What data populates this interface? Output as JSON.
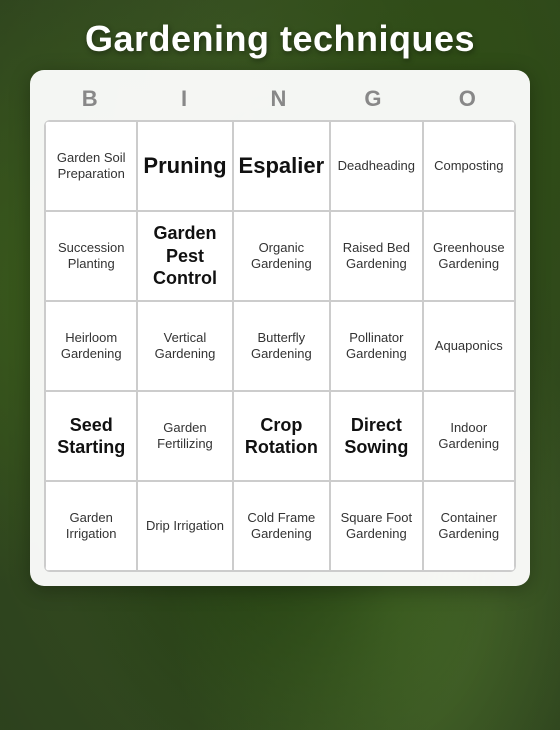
{
  "title": "Gardening techniques",
  "bingo_letters": [
    "B",
    "I",
    "N",
    "G",
    "O"
  ],
  "cells": [
    {
      "text": "Garden Soil Preparation",
      "size": "small"
    },
    {
      "text": "Pruning",
      "size": "large"
    },
    {
      "text": "Espalier",
      "size": "large"
    },
    {
      "text": "Deadheading",
      "size": "small"
    },
    {
      "text": "Composting",
      "size": "small"
    },
    {
      "text": "Succession Planting",
      "size": "small"
    },
    {
      "text": "Garden Pest Control",
      "size": "medium"
    },
    {
      "text": "Organic Gardening",
      "size": "small"
    },
    {
      "text": "Raised Bed Gardening",
      "size": "small"
    },
    {
      "text": "Greenhouse Gardening",
      "size": "small"
    },
    {
      "text": "Heirloom Gardening",
      "size": "small"
    },
    {
      "text": "Vertical Gardening",
      "size": "small"
    },
    {
      "text": "Butterfly Gardening",
      "size": "small"
    },
    {
      "text": "Pollinator Gardening",
      "size": "small"
    },
    {
      "text": "Aquaponics",
      "size": "small"
    },
    {
      "text": "Seed Starting",
      "size": "medium"
    },
    {
      "text": "Garden Fertilizing",
      "size": "small"
    },
    {
      "text": "Crop Rotation",
      "size": "medium"
    },
    {
      "text": "Direct Sowing",
      "size": "medium"
    },
    {
      "text": "Indoor Gardening",
      "size": "small"
    },
    {
      "text": "Garden Irrigation",
      "size": "small"
    },
    {
      "text": "Drip Irrigation",
      "size": "small"
    },
    {
      "text": "Cold Frame Gardening",
      "size": "small"
    },
    {
      "text": "Square Foot Gardening",
      "size": "small"
    },
    {
      "text": "Container Gardening",
      "size": "small"
    }
  ]
}
